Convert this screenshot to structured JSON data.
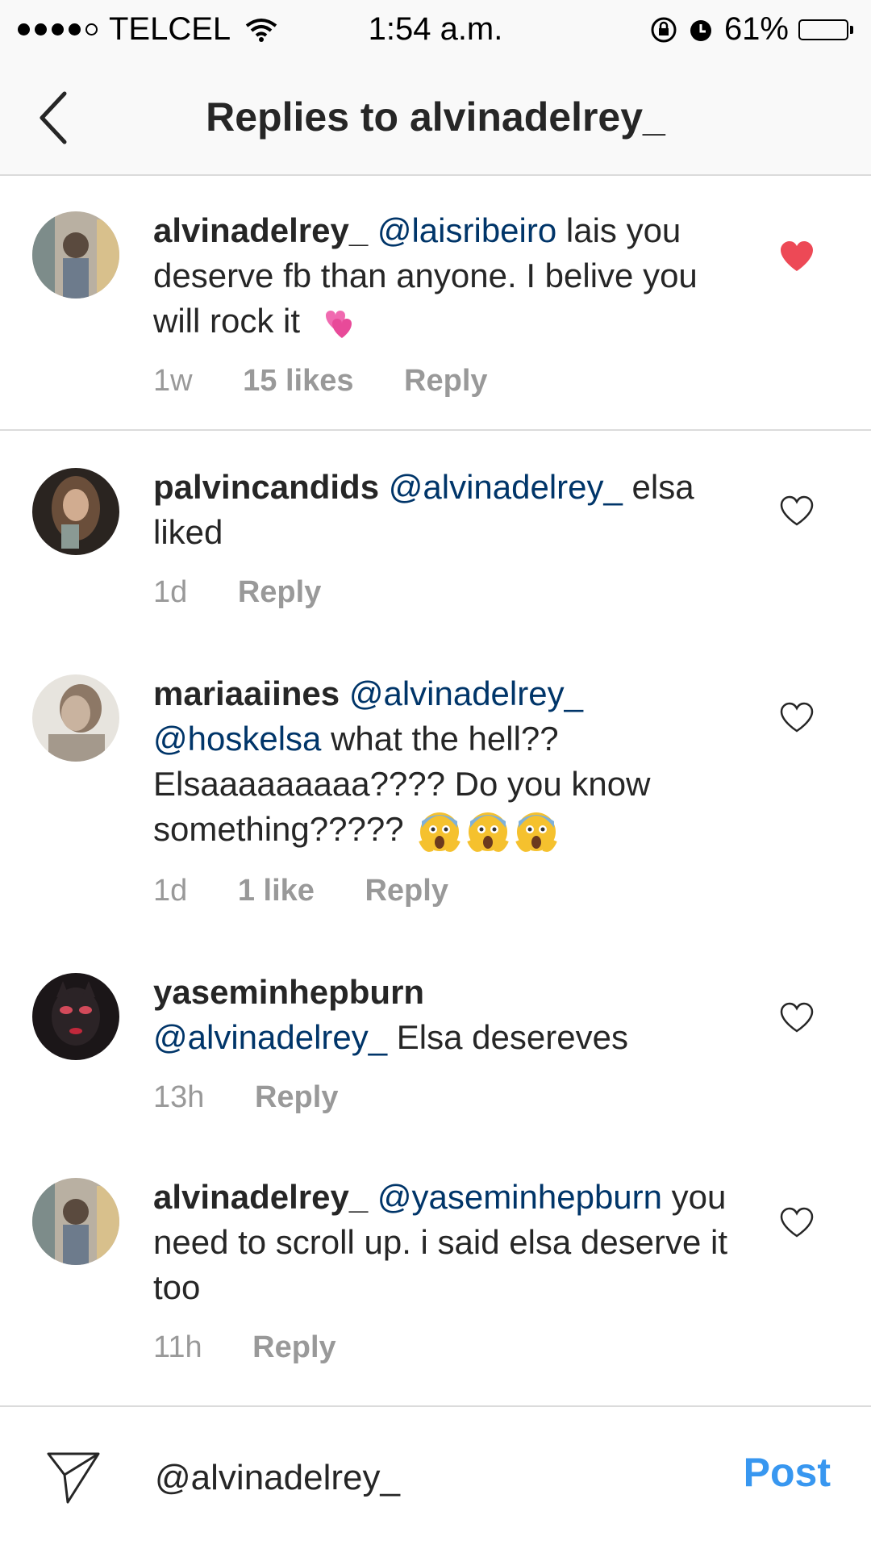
{
  "status_bar": {
    "carrier": "TELCEL",
    "time": "1:54 a.m.",
    "battery": "61%",
    "battery_level": 0.61
  },
  "header": {
    "title": "Replies to alvinadelrey_"
  },
  "comments": [
    {
      "username": "alvinadelrey_",
      "mention": "@laisribeiro",
      "text": " lais you deserve fb than anyone. I belive you will rock it",
      "time": "1w",
      "likes": "15 likes",
      "reply": "Reply",
      "liked": true,
      "emoji": "two-hearts"
    },
    {
      "username": "palvincandids",
      "mention": "@alvinadelrey_",
      "text": " elsa liked",
      "time": "1d",
      "likes": "",
      "reply": "Reply",
      "liked": false
    },
    {
      "username": "mariaaiines",
      "mention": "@alvinadelrey_",
      "mention2": "@hoskelsa",
      "text": " what the hell?? Elsaaaaaaaaa???? Do you know something?????",
      "time": "1d",
      "likes": "1 like",
      "reply": "Reply",
      "liked": false,
      "emoji": "screaming-face x3"
    },
    {
      "username": "yaseminhepburn",
      "mention": "@alvinadelrey_",
      "text": " Elsa desereves",
      "time": "13h",
      "likes": "",
      "reply": "Reply",
      "liked": false
    },
    {
      "username": "alvinadelrey_",
      "mention": "@yaseminhepburn",
      "text": " you need to scroll up. i said elsa deserve it too",
      "time": "11h",
      "likes": "",
      "reply": "Reply",
      "liked": false
    }
  ],
  "composer": {
    "value": "@alvinadelrey_",
    "post_label": "Post"
  },
  "colors": {
    "liked_heart": "#ed4956",
    "mention": "#003569",
    "post_button": "#3897f0",
    "meta_text": "#999999"
  }
}
